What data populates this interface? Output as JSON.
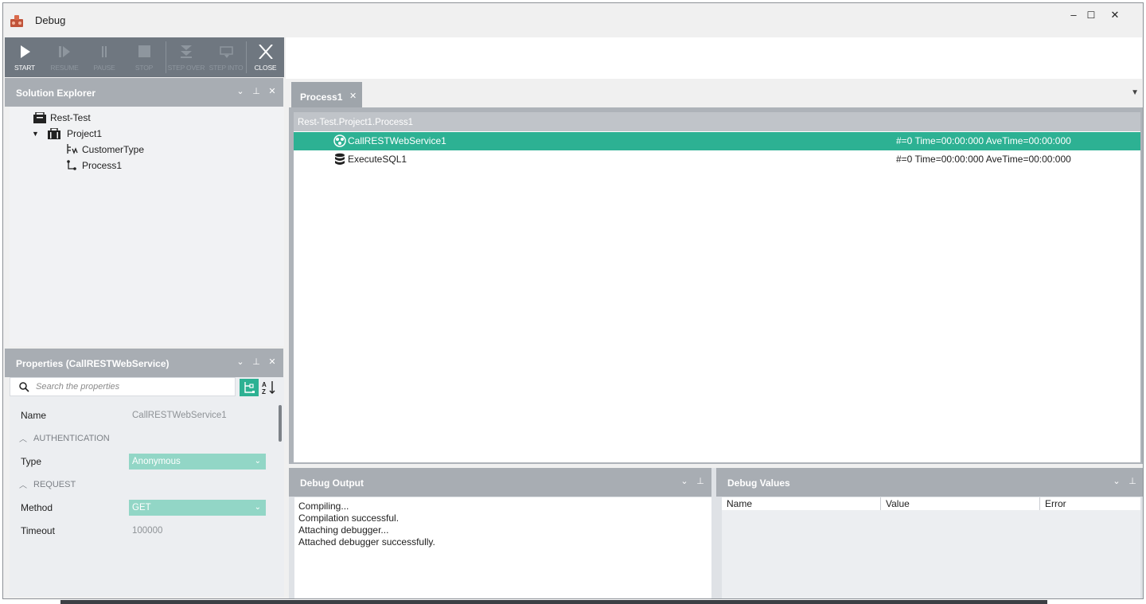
{
  "window": {
    "title": "Debug",
    "controls": {
      "minimize": "–",
      "maximize": "☐",
      "close": "✕"
    }
  },
  "toolbar": {
    "buttons": [
      {
        "label": "START",
        "icon": "play-icon",
        "enabled": true
      },
      {
        "label": "RESUME",
        "icon": "resume-icon",
        "enabled": false
      },
      {
        "label": "PAUSE",
        "icon": "pause-icon",
        "enabled": false
      },
      {
        "label": "STOP",
        "icon": "stop-icon",
        "enabled": false
      },
      {
        "label": "STEP OVER",
        "icon": "step-over-icon",
        "enabled": false
      },
      {
        "label": "STEP INTO",
        "icon": "step-into-icon",
        "enabled": false
      },
      {
        "label": "CLOSE",
        "icon": "close-icon",
        "enabled": true
      }
    ]
  },
  "solution_explorer": {
    "title": "Solution Explorer",
    "tree": [
      {
        "label": "Rest-Test",
        "icon": "solution-icon"
      },
      {
        "label": "Project1",
        "icon": "project-icon",
        "expanded": true
      },
      {
        "label": "CustomerType",
        "icon": "type-icon"
      },
      {
        "label": "Process1",
        "icon": "process-icon"
      }
    ]
  },
  "properties": {
    "title": "Properties (CallRESTWebService)",
    "search_placeholder": "Search the properties",
    "rows": {
      "name": {
        "label": "Name",
        "value": "CallRESTWebService1"
      },
      "auth_category": "AUTHENTICATION",
      "type": {
        "label": "Type",
        "value": "Anonymous"
      },
      "request_category": "REQUEST",
      "method": {
        "label": "Method",
        "value": "GET"
      },
      "timeout": {
        "label": "Timeout",
        "value": "100000"
      }
    }
  },
  "document": {
    "tab_label": "Process1",
    "tab_close": "✕",
    "path": "Rest-Test.Project1.Process1",
    "rows": [
      {
        "name": "CallRESTWebService1",
        "stats": "#=0 Time=00:00:000 AveTime=00:00:000",
        "icon": "web-service-icon",
        "selected": true
      },
      {
        "name": "ExecuteSQL1",
        "stats": "#=0 Time=00:00:000 AveTime=00:00:000",
        "icon": "database-icon",
        "selected": false
      }
    ]
  },
  "debug_output": {
    "title": "Debug Output",
    "lines": [
      "Compiling...",
      "Compilation successful.",
      "Attaching debugger...",
      "Attached debugger successfully."
    ]
  },
  "debug_values": {
    "title": "Debug Values",
    "columns": [
      "Name",
      "Value",
      "Error"
    ]
  },
  "colors": {
    "accent": "#2db193",
    "panel_header": "#a8adb3",
    "toolbar": "#6f7780",
    "select_field": "#92d6c6"
  }
}
